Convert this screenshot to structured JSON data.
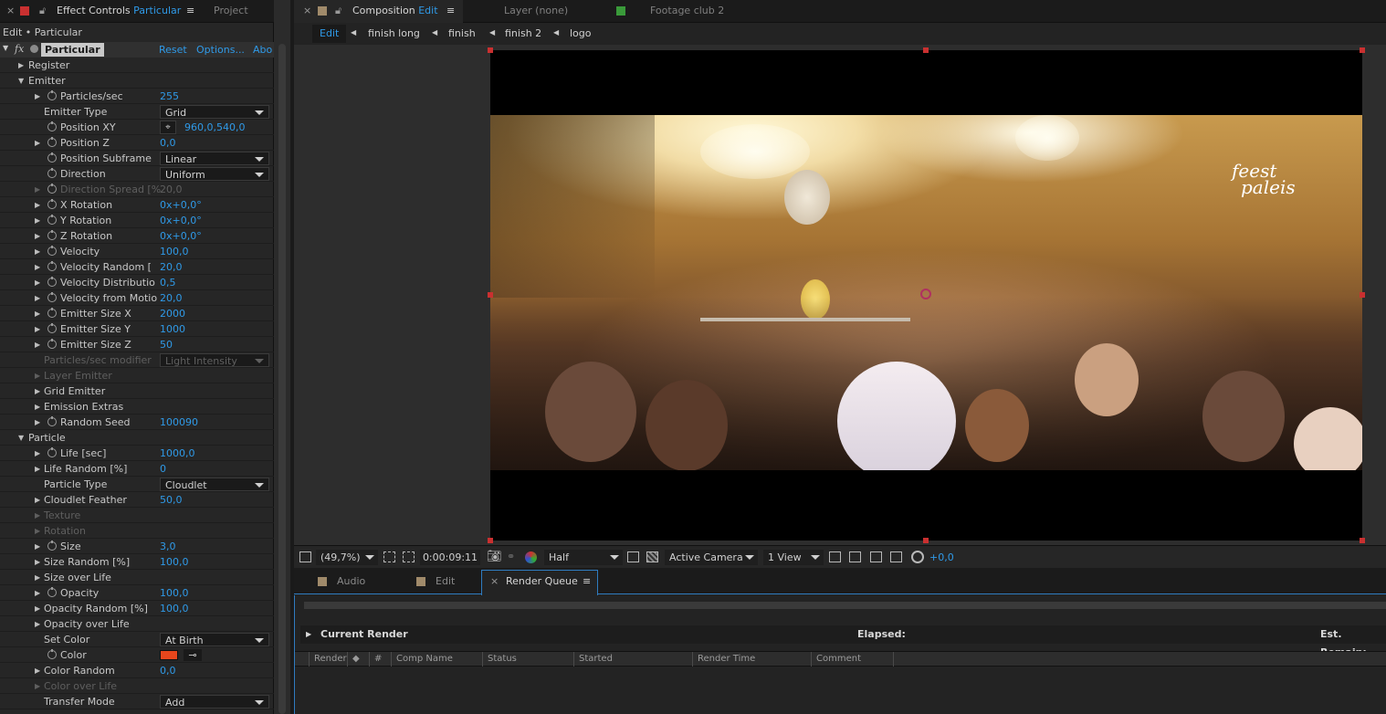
{
  "effect_panel": {
    "tab_title": "Effect Controls",
    "tab_layer": "Particular",
    "project_tab": "Project",
    "breadcrumb": "Edit • Particular",
    "effect_name": "Particular",
    "reset": "Reset",
    "options": "Options...",
    "about": "Abo",
    "rows": [
      {
        "label": "Register",
        "arrow": "▶",
        "indent": 1,
        "stopwatch": false,
        "value": "",
        "type": "group"
      },
      {
        "label": "Emitter",
        "arrow": "▼",
        "indent": 1,
        "stopwatch": false,
        "value": "",
        "type": "group"
      },
      {
        "label": "Particles/sec",
        "arrow": "▶",
        "indent": 3,
        "stopwatch": true,
        "value": "255",
        "type": "value"
      },
      {
        "label": "Emitter Type",
        "arrow": "",
        "indent": 2,
        "stopwatch": false,
        "value": "Grid",
        "type": "dropdown"
      },
      {
        "label": "Position XY",
        "arrow": "",
        "indent": 3,
        "stopwatch": true,
        "value": "960,0,540,0",
        "type": "point"
      },
      {
        "label": "Position Z",
        "arrow": "▶",
        "indent": 3,
        "stopwatch": true,
        "value": "0,0",
        "type": "value"
      },
      {
        "label": "Position Subframe",
        "arrow": "",
        "indent": 3,
        "stopwatch": true,
        "value": "Linear",
        "type": "dropdown"
      },
      {
        "label": "Direction",
        "arrow": "",
        "indent": 3,
        "stopwatch": true,
        "value": "Uniform",
        "type": "dropdown"
      },
      {
        "label": "Direction Spread [%",
        "arrow": "▶",
        "indent": 3,
        "stopwatch": true,
        "value": "20,0",
        "type": "value-dim"
      },
      {
        "label": "X Rotation",
        "arrow": "▶",
        "indent": 3,
        "stopwatch": true,
        "value": "0x+0,0°",
        "type": "value"
      },
      {
        "label": "Y Rotation",
        "arrow": "▶",
        "indent": 3,
        "stopwatch": true,
        "value": "0x+0,0°",
        "type": "value"
      },
      {
        "label": "Z Rotation",
        "arrow": "▶",
        "indent": 3,
        "stopwatch": true,
        "value": "0x+0,0°",
        "type": "value"
      },
      {
        "label": "Velocity",
        "arrow": "▶",
        "indent": 3,
        "stopwatch": true,
        "value": "100,0",
        "type": "value"
      },
      {
        "label": "Velocity Random [",
        "arrow": "▶",
        "indent": 3,
        "stopwatch": true,
        "value": "20,0",
        "type": "value"
      },
      {
        "label": "Velocity Distributio",
        "arrow": "▶",
        "indent": 3,
        "stopwatch": true,
        "value": "0,5",
        "type": "value"
      },
      {
        "label": "Velocity from Motio",
        "arrow": "▶",
        "indent": 3,
        "stopwatch": true,
        "value": "20,0",
        "type": "value"
      },
      {
        "label": "Emitter Size X",
        "arrow": "▶",
        "indent": 3,
        "stopwatch": true,
        "value": "2000",
        "type": "value"
      },
      {
        "label": "Emitter Size Y",
        "arrow": "▶",
        "indent": 3,
        "stopwatch": true,
        "value": "1000",
        "type": "value"
      },
      {
        "label": "Emitter Size Z",
        "arrow": "▶",
        "indent": 3,
        "stopwatch": true,
        "value": "50",
        "type": "value"
      },
      {
        "label": "Particles/sec modifier",
        "arrow": "",
        "indent": 2,
        "stopwatch": false,
        "value": "Light Intensity",
        "type": "dropdown-dim"
      },
      {
        "label": "Layer Emitter",
        "arrow": "▶",
        "indent": 2,
        "stopwatch": false,
        "value": "",
        "type": "group-dim"
      },
      {
        "label": "Grid Emitter",
        "arrow": "▶",
        "indent": 2,
        "stopwatch": false,
        "value": "",
        "type": "group"
      },
      {
        "label": "Emission Extras",
        "arrow": "▶",
        "indent": 2,
        "stopwatch": false,
        "value": "",
        "type": "group"
      },
      {
        "label": "Random Seed",
        "arrow": "▶",
        "indent": 3,
        "stopwatch": true,
        "value": "100090",
        "type": "value"
      },
      {
        "label": "Particle",
        "arrow": "▼",
        "indent": 1,
        "stopwatch": false,
        "value": "",
        "type": "group"
      },
      {
        "label": "Life [sec]",
        "arrow": "▶",
        "indent": 3,
        "stopwatch": true,
        "value": "1000,0",
        "type": "value"
      },
      {
        "label": "Life Random [%]",
        "arrow": "▶",
        "indent": 2,
        "stopwatch": false,
        "value": "0",
        "type": "value"
      },
      {
        "label": "Particle Type",
        "arrow": "",
        "indent": 2,
        "stopwatch": false,
        "value": "Cloudlet",
        "type": "dropdown"
      },
      {
        "label": "Cloudlet Feather",
        "arrow": "▶",
        "indent": 2,
        "stopwatch": false,
        "value": "50,0",
        "type": "value"
      },
      {
        "label": "Texture",
        "arrow": "▶",
        "indent": 2,
        "stopwatch": false,
        "value": "",
        "type": "group-dim"
      },
      {
        "label": "Rotation",
        "arrow": "▶",
        "indent": 2,
        "stopwatch": false,
        "value": "",
        "type": "group-dim"
      },
      {
        "label": "Size",
        "arrow": "▶",
        "indent": 3,
        "stopwatch": true,
        "value": "3,0",
        "type": "value"
      },
      {
        "label": "Size Random [%]",
        "arrow": "▶",
        "indent": 2,
        "stopwatch": false,
        "value": "100,0",
        "type": "value"
      },
      {
        "label": "Size over Life",
        "arrow": "▶",
        "indent": 2,
        "stopwatch": false,
        "value": "",
        "type": "group"
      },
      {
        "label": "Opacity",
        "arrow": "▶",
        "indent": 3,
        "stopwatch": true,
        "value": "100,0",
        "type": "value"
      },
      {
        "label": "Opacity Random [%]",
        "arrow": "▶",
        "indent": 2,
        "stopwatch": false,
        "value": "100,0",
        "type": "value"
      },
      {
        "label": "Opacity over Life",
        "arrow": "▶",
        "indent": 2,
        "stopwatch": false,
        "value": "",
        "type": "group"
      },
      {
        "label": "Set Color",
        "arrow": "",
        "indent": 2,
        "stopwatch": false,
        "value": "At Birth",
        "type": "dropdown"
      },
      {
        "label": "Color",
        "arrow": "",
        "indent": 3,
        "stopwatch": true,
        "value": "",
        "type": "color"
      },
      {
        "label": "Color Random",
        "arrow": "▶",
        "indent": 2,
        "stopwatch": false,
        "value": "0,0",
        "type": "value"
      },
      {
        "label": "Color over Life",
        "arrow": "▶",
        "indent": 2,
        "stopwatch": false,
        "value": "",
        "type": "group-dim"
      },
      {
        "label": "Transfer Mode",
        "arrow": "",
        "indent": 2,
        "stopwatch": false,
        "value": "Add",
        "type": "dropdown"
      }
    ],
    "color_swatch": "#e8461c"
  },
  "comp_panel": {
    "tab_title": "Composition",
    "tab_comp": "Edit",
    "layer_tab": "Layer (none)",
    "footage_tab": "Footage club 2",
    "nav": [
      "Edit",
      "finish long",
      "finish",
      "finish 2",
      "logo"
    ],
    "logo_text_1": "feest",
    "logo_text_2": "paleis",
    "toolbar": {
      "zoom": "(49,7%)",
      "timecode": "0:00:09:11",
      "resolution": "Half",
      "camera": "Active Camera",
      "views": "1 View",
      "exposure": "+0,0"
    }
  },
  "bottom_panel": {
    "tabs": [
      "Audio",
      "Edit",
      "Render Queue"
    ],
    "current_render": "Current Render",
    "elapsed": "Elapsed:",
    "est_remain": "Est. Remain:",
    "columns": [
      "Render",
      "#",
      "Comp Name",
      "Status",
      "Started",
      "Render Time",
      "Comment"
    ]
  },
  "colors": {
    "accent_blue": "#2f9ae8",
    "handle_red": "#c93030"
  }
}
